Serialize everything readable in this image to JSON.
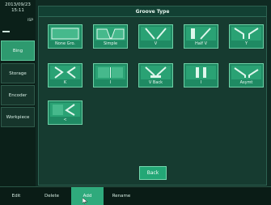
{
  "sidebar": {
    "date": "2013/09/23",
    "time": "15:11",
    "unit": "ISP",
    "items": [
      {
        "label": "Bing",
        "active": true
      },
      {
        "label": "Storage",
        "active": false
      },
      {
        "label": "Encoder",
        "active": false
      },
      {
        "label": "Workpiece",
        "active": false
      }
    ]
  },
  "dialog": {
    "title": "Groove Type",
    "back_label": "Back",
    "grooves": [
      {
        "label": "None Gro.",
        "icon": "groove-none-icon"
      },
      {
        "label": "Simple",
        "icon": "groove-simple-icon"
      },
      {
        "label": "V",
        "icon": "groove-v-icon"
      },
      {
        "label": "Half V",
        "icon": "groove-half-v-icon"
      },
      {
        "label": "Y",
        "icon": "groove-y-icon"
      },
      {
        "label": "K",
        "icon": "groove-k-icon"
      },
      {
        "label": "I",
        "icon": "groove-i-icon"
      },
      {
        "label": "V Back",
        "icon": "groove-v-back-icon"
      },
      {
        "label": "I",
        "icon": "groove-i-gap-icon"
      },
      {
        "label": "Asymt",
        "icon": "groove-asymmetric-icon"
      },
      {
        "label": "<",
        "icon": "groove-angle-icon"
      }
    ]
  },
  "bottombar": {
    "items": [
      {
        "label": "Edit",
        "active": false
      },
      {
        "label": "Delete",
        "active": false
      },
      {
        "label": "Add",
        "active": true
      },
      {
        "label": "Rename",
        "active": false
      }
    ]
  },
  "colors": {
    "background": "#0f2a22",
    "dialog": "#163b30",
    "button": "#1f8a63",
    "accent": "#2faa7c",
    "text": "#e8f8f0"
  }
}
